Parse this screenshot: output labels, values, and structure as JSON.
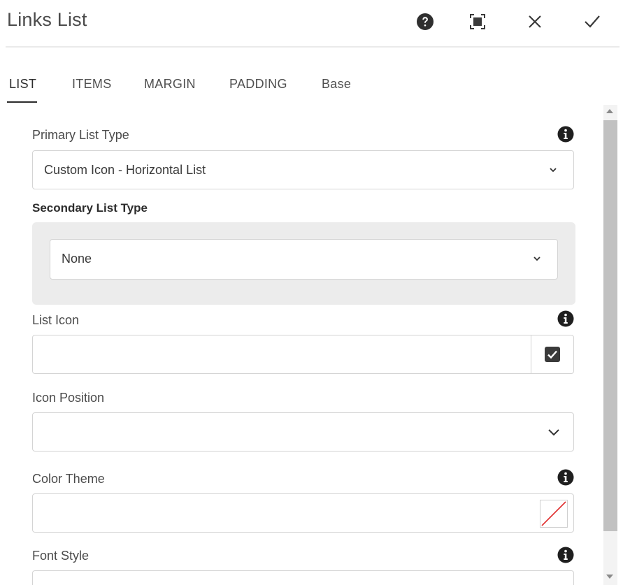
{
  "dialog": {
    "title": "Links List",
    "buttons": {
      "help": "help-icon",
      "fullscreen": "fullscreen-icon",
      "close": "close-icon",
      "done": "checkmark-icon"
    }
  },
  "tabs": [
    {
      "label": "LIST",
      "active": true
    },
    {
      "label": "ITEMS",
      "active": false
    },
    {
      "label": "MARGIN",
      "active": false
    },
    {
      "label": "PADDING",
      "active": false
    },
    {
      "label": "Base",
      "active": false
    }
  ],
  "form": {
    "primary_list_type": {
      "label": "Primary List Type",
      "value": "Custom Icon - Horizontal List"
    },
    "secondary_list_type": {
      "label": "Secondary List Type",
      "value": "None"
    },
    "list_icon": {
      "label": "List Icon",
      "value": ""
    },
    "icon_position": {
      "label": "Icon Position",
      "value": ""
    },
    "color_theme": {
      "label": "Color Theme",
      "value": ""
    },
    "font_style": {
      "label": "Font Style",
      "value": ""
    }
  },
  "colors": {
    "text": "#323232",
    "border": "#d4d4d4",
    "secondary_bg": "#ececec",
    "swatch_line": "#e03131"
  }
}
